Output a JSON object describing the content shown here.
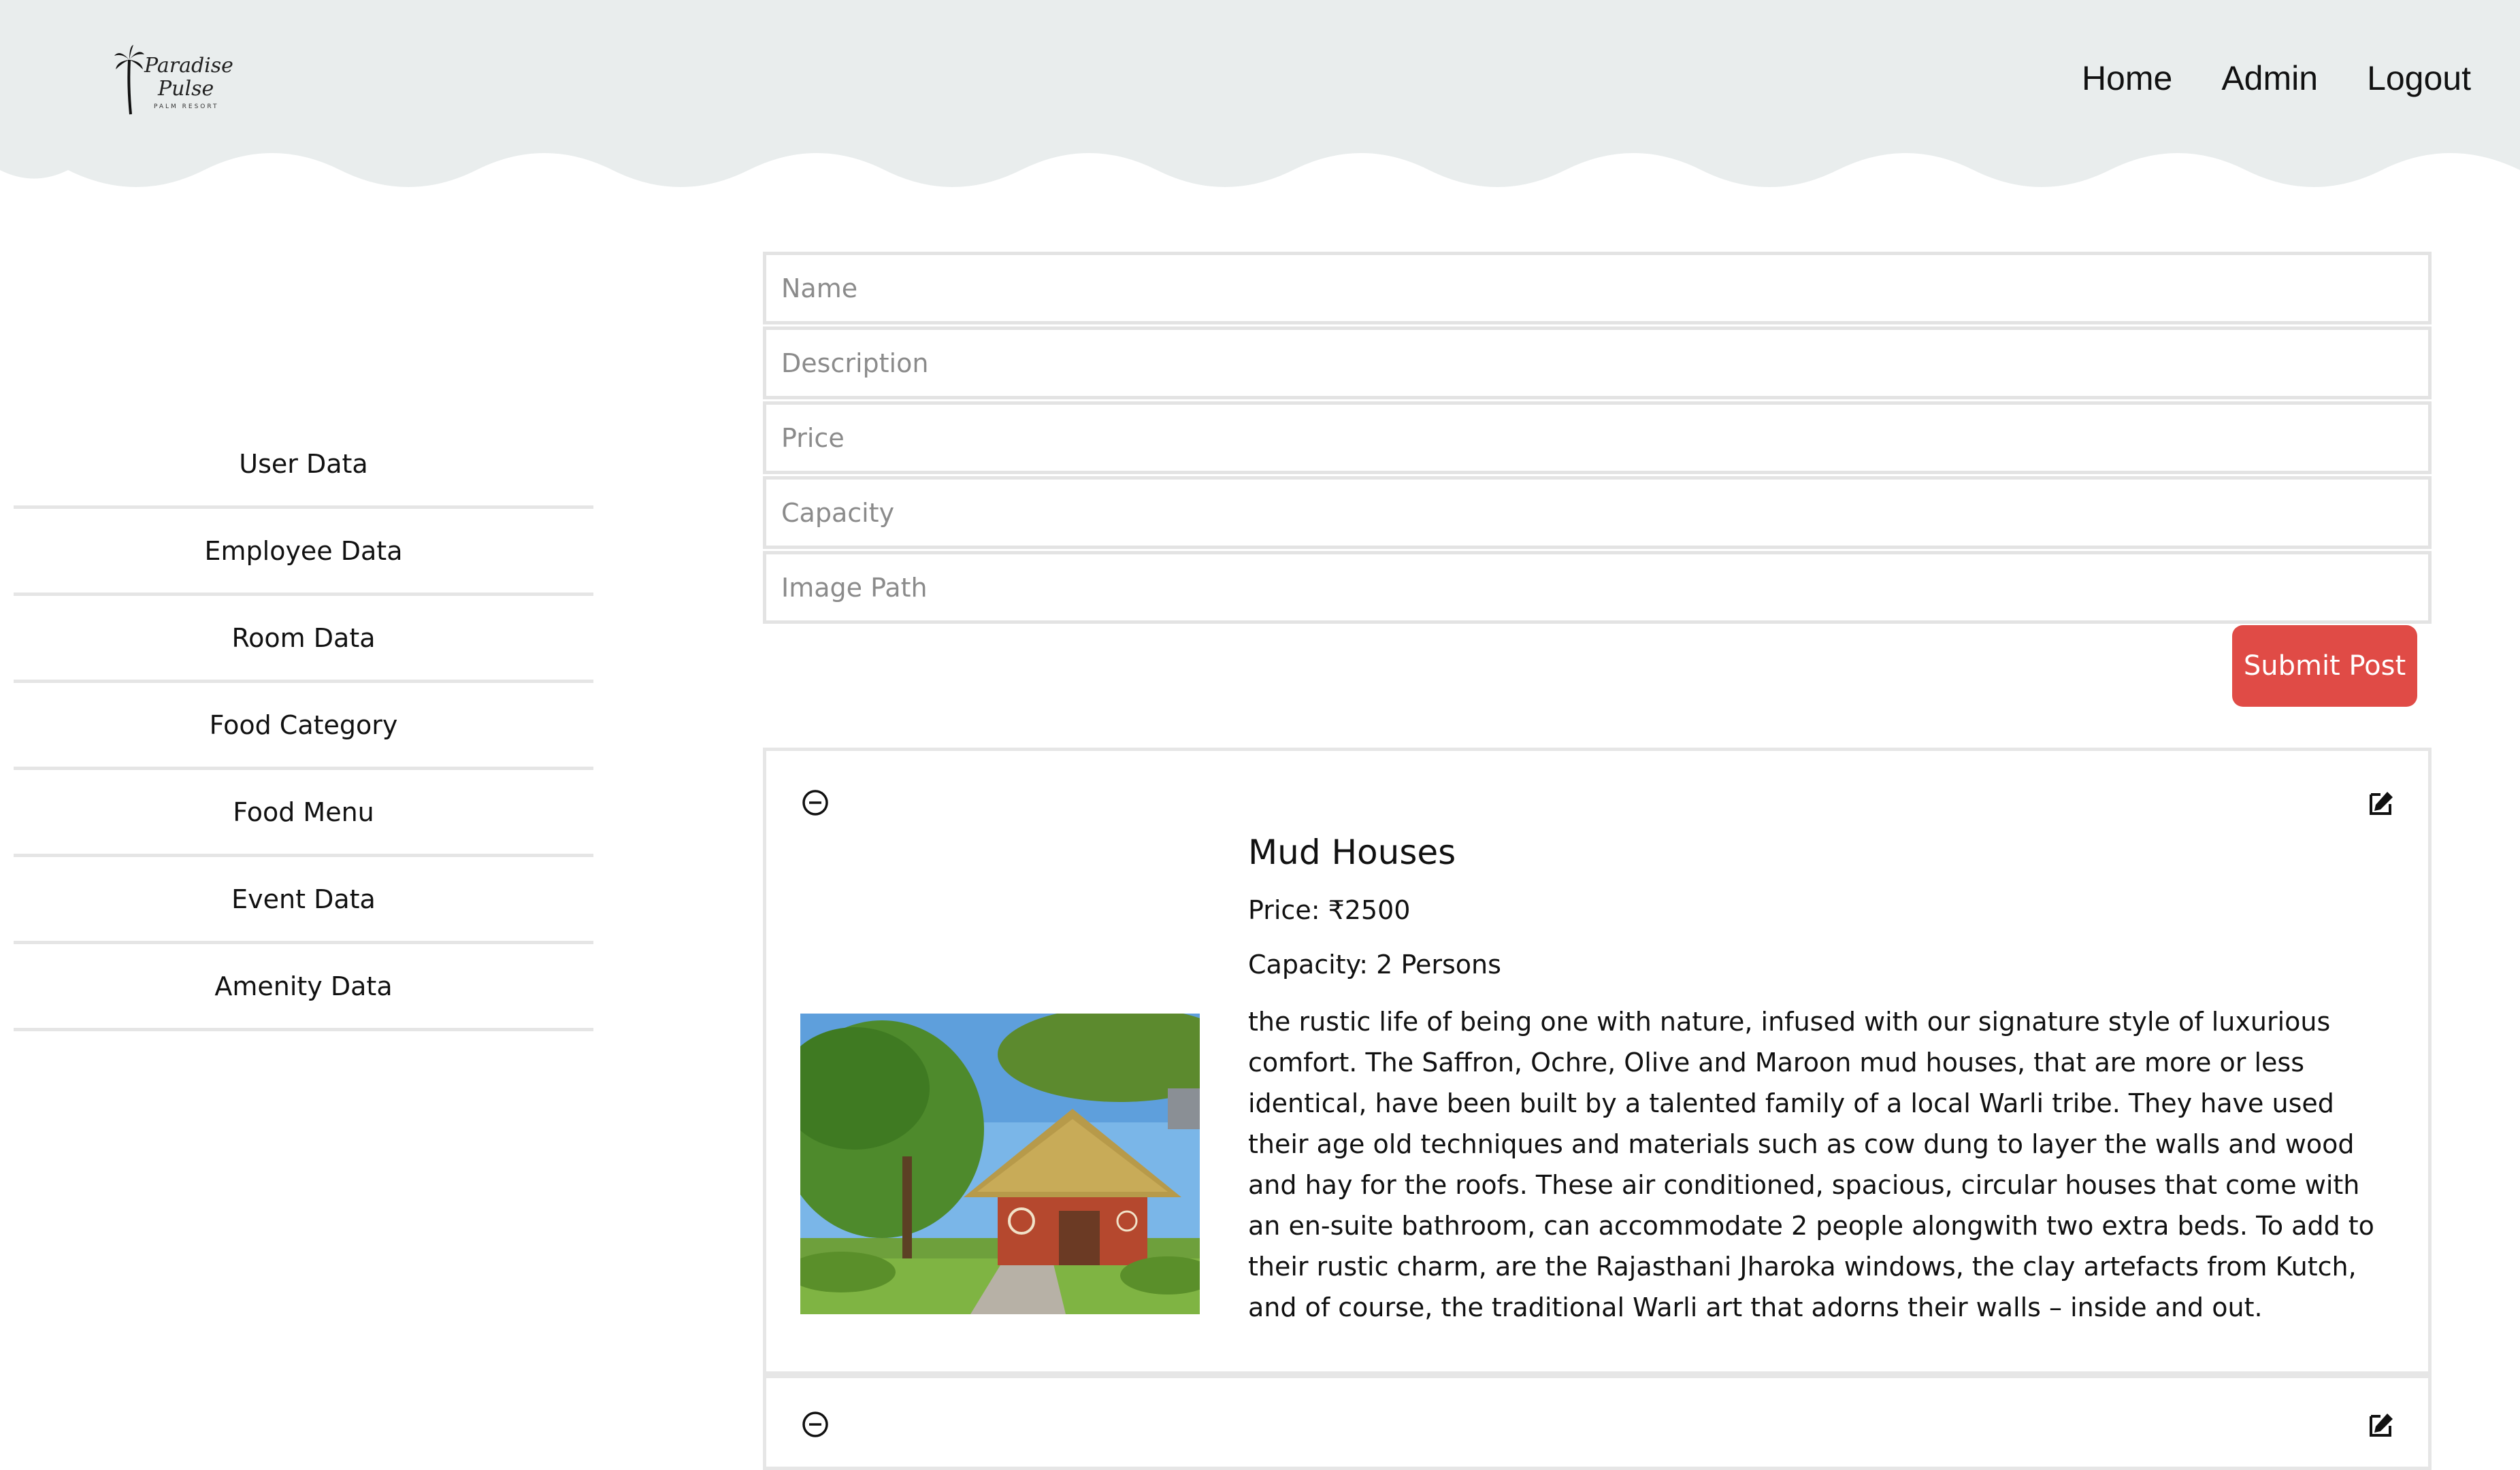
{
  "brand": {
    "line1": "Paradise",
    "line2": "Pulse",
    "tagline": "PALM RESORT"
  },
  "nav": {
    "home": "Home",
    "admin": "Admin",
    "logout": "Logout"
  },
  "sidebar": {
    "items": [
      {
        "label": "User Data"
      },
      {
        "label": "Employee Data"
      },
      {
        "label": "Room Data"
      },
      {
        "label": "Food Category"
      },
      {
        "label": "Food Menu"
      },
      {
        "label": "Event Data"
      },
      {
        "label": "Amenity Data"
      }
    ]
  },
  "form": {
    "name_placeholder": "Name",
    "description_placeholder": "Description",
    "price_placeholder": "Price",
    "capacity_placeholder": "Capacity",
    "image_path_placeholder": "Image Path",
    "submit_label": "Submit Post"
  },
  "rooms": [
    {
      "title": "Mud Houses",
      "price": "Price: ₹2500",
      "capacity": "Capacity: 2 Persons",
      "description": "the rustic life of being one with nature, infused with our signature style of luxurious comfort. The Saffron, Ochre, Olive and Maroon mud houses, that are more or less identical, have been built by a talented family of a local Warli tribe. They have used their age old techniques and materials such as cow dung to layer the walls and wood and hay for the roofs. These air conditioned, spacious, circular houses that come with an en-suite bathroom, can accommodate 2 people alongwith two extra beds. To add to their rustic charm, are the Rajasthani Jharoka windows, the clay artefacts from Kutch, and of course, the traditional Warli art that adorns their walls – inside and out."
    }
  ],
  "colors": {
    "header_bg": "#e9eded",
    "accent": "#e04b46",
    "border": "#e5e5e5"
  },
  "icons": {
    "remove": "minus-circle-icon",
    "edit": "edit-icon",
    "logo": "palm-tree-icon"
  }
}
